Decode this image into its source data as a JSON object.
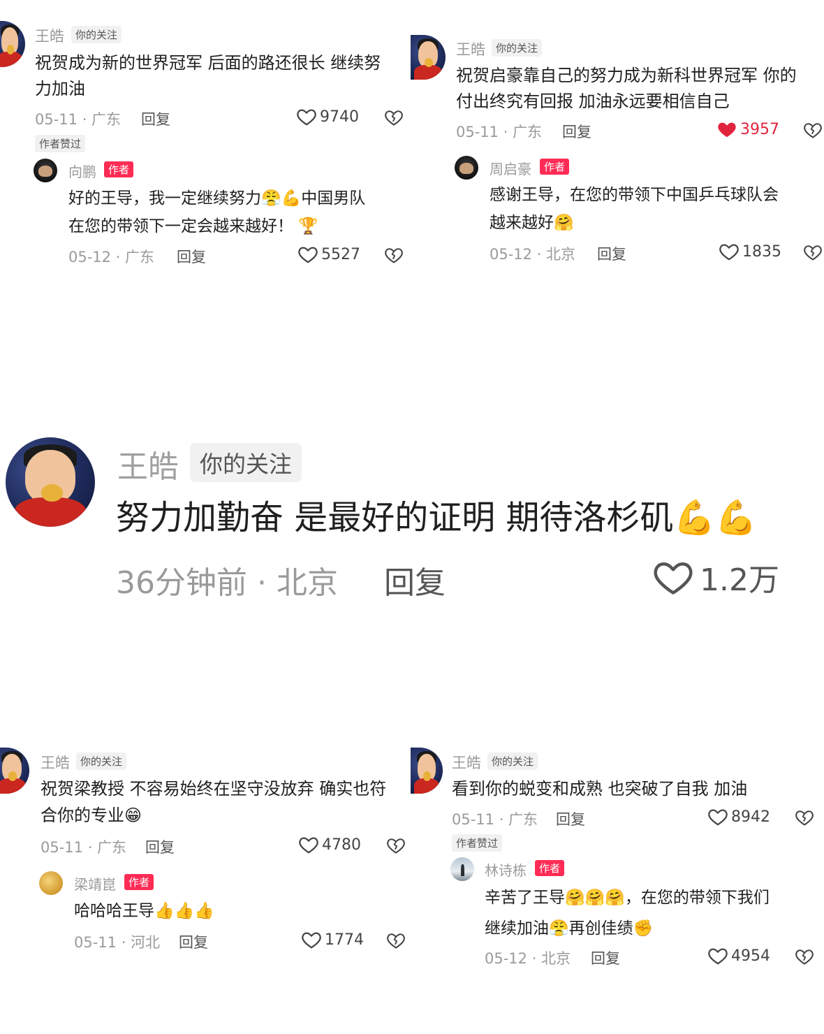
{
  "icons": {
    "heart": "heart-outline-icon",
    "heart_filled": "heart-filled-icon",
    "dislike": "broken-heart-icon",
    "trophy": "trophy-emoji",
    "muscle": "flexed-biceps-emoji",
    "thumbs": "thumbs-up-emoji",
    "hug": "hugging-emoji",
    "grin": "grinning-emoji",
    "fist": "raised-fist-emoji"
  },
  "colors": {
    "accent": "#fe2c55",
    "liked": "#e1243d",
    "muted": "#9a9a9a"
  },
  "c1": {
    "name": "王皓",
    "tag": "你的关注",
    "text_line1": "祝贺成为新的世界冠军 后面的路还很长 继续努",
    "text_line2": "力加油",
    "meta": "05-11 · 广东",
    "reply": "回复",
    "likes": "9740",
    "liked_tag": "作者赞过",
    "reply_comment": {
      "name": "向鹏",
      "tag": "作者",
      "text_line1": "好的王导，我一定继续努力",
      "text_line1b": "中国男队",
      "text_line2": "在您的带领下一定会越来越好！",
      "meta": "05-12 · 广东",
      "reply": "回复",
      "likes": "5527"
    }
  },
  "c2": {
    "name": "王皓",
    "tag": "你的关注",
    "text_line1": "祝贺启豪靠自己的努力成为新科世界冠军 你的",
    "text_line2": "付出终究有回报 加油永远要相信自己",
    "meta": "05-11 · 广东",
    "reply": "回复",
    "likes": "3957",
    "reply_comment": {
      "name": "周启豪",
      "tag": "作者",
      "text_line1": "感谢王导，在您的带领下中国乒乓球队会",
      "text_line2": "越来越好",
      "meta": "05-12 · 北京",
      "reply": "回复",
      "likes": "1835"
    }
  },
  "main": {
    "name": "王皓",
    "tag": "你的关注",
    "text": "努力加勤奋 是最好的证明 期待洛杉矶",
    "meta": "36分钟前 · 北京",
    "reply": "回复",
    "likes": "1.2万"
  },
  "c3": {
    "name": "王皓",
    "tag": "你的关注",
    "text_line1": "祝贺梁教授 不容易始终在坚守没放弃 确实也符",
    "text_line2": "合你的专业",
    "meta": "05-11 · 广东",
    "reply": "回复",
    "likes": "4780",
    "reply_comment": {
      "name": "梁靖崑",
      "tag": "作者",
      "text_line1": "哈哈哈王导",
      "meta": "05-11 · 河北",
      "reply": "回复",
      "likes": "1774"
    }
  },
  "c4": {
    "name": "王皓",
    "tag": "你的关注",
    "text_line1": "看到你的蜕变和成熟 也突破了自我 加油",
    "meta": "05-11 · 广东",
    "reply": "回复",
    "likes": "8942",
    "liked_tag": "作者赞过",
    "reply_comment": {
      "name": "林诗栋",
      "tag": "作者",
      "text_line1": "辛苦了王导",
      "text_line1b": "，在您的带领下我们",
      "text_line2": "继续加油",
      "text_line2b": "再创佳绩",
      "meta": "05-12 · 北京",
      "reply": "回复",
      "likes": "4954"
    }
  }
}
